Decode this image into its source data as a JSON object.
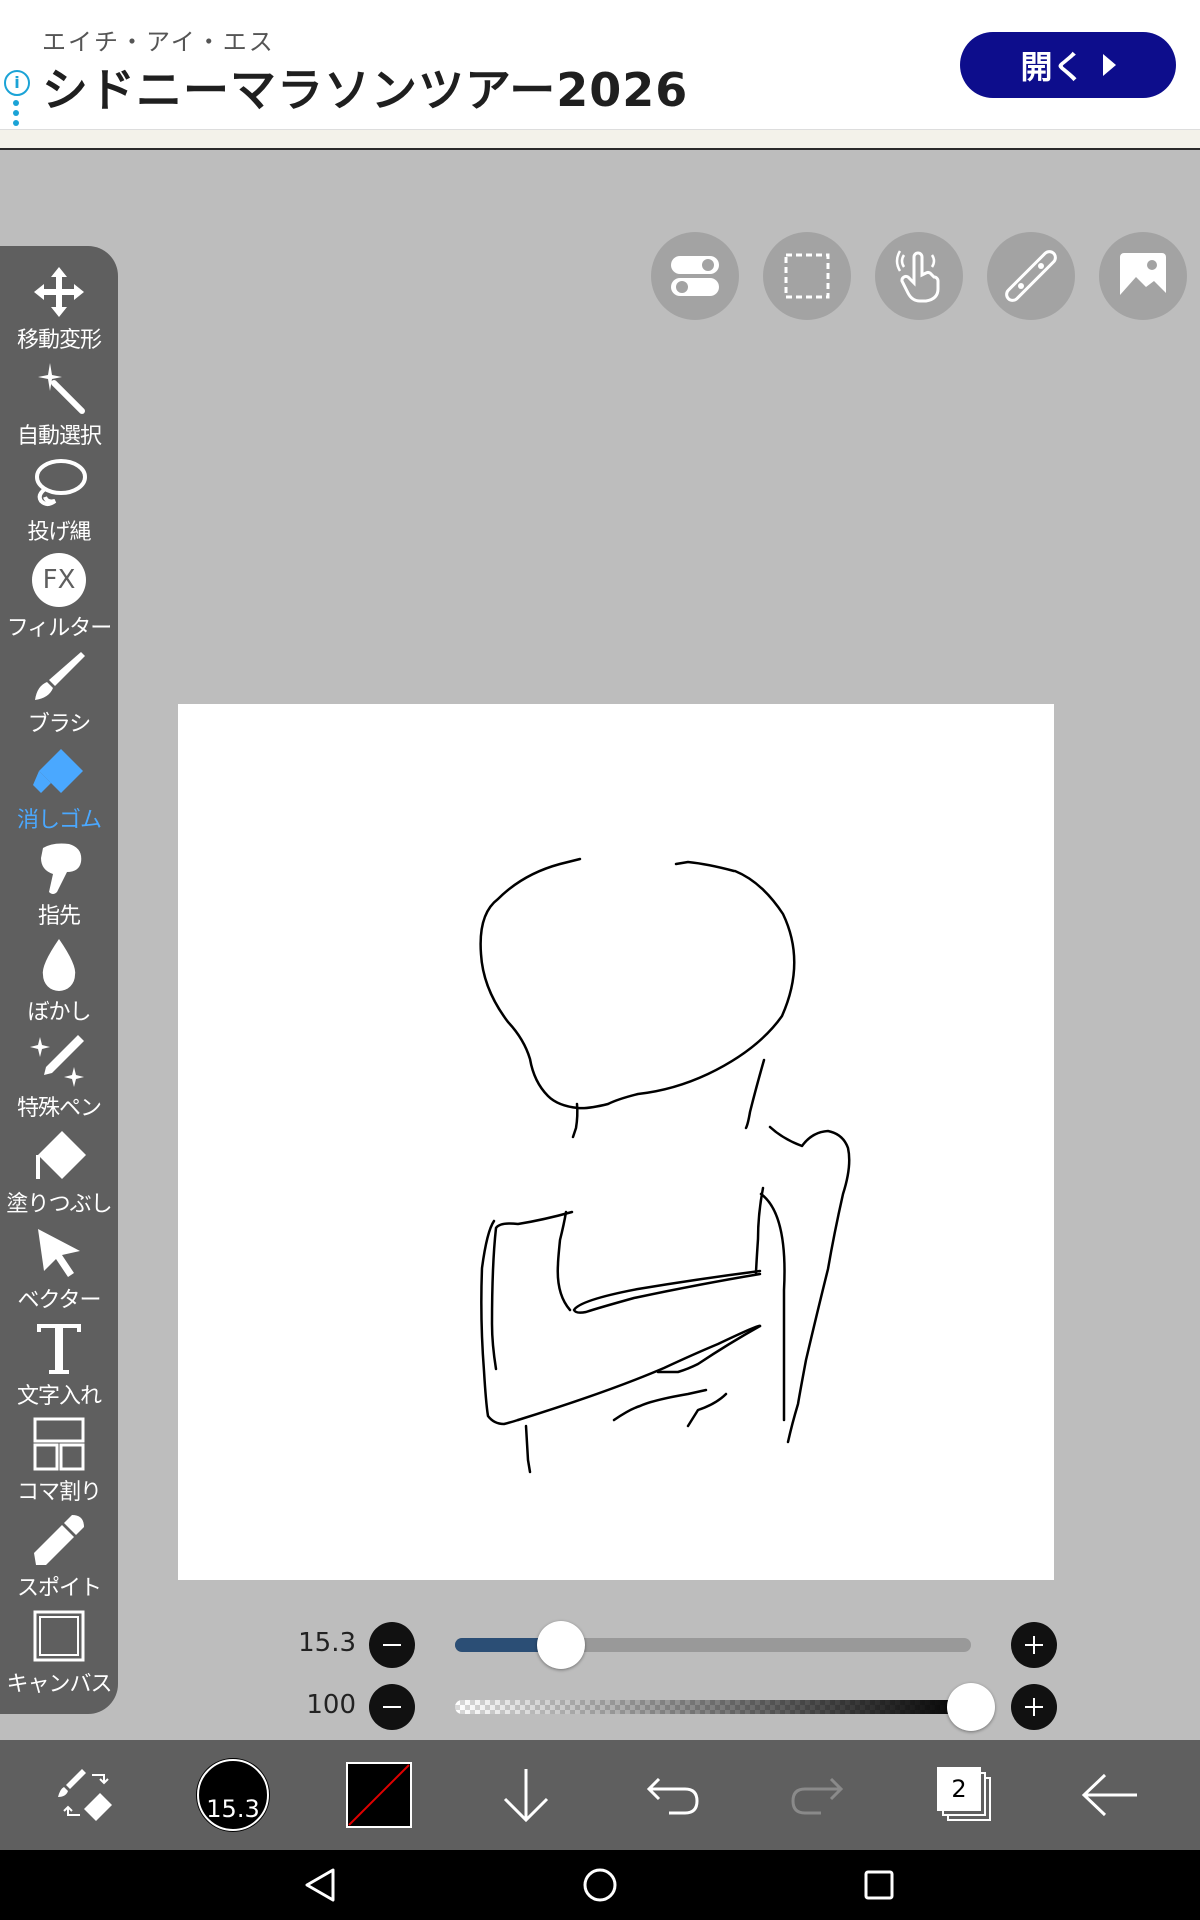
{
  "ad": {
    "subtitle": "エイチ・アイ・エス",
    "title": "シドニーマラソンツアー2026",
    "open_label": "開く",
    "info_icon": "i"
  },
  "tools": [
    {
      "label": "移動変形",
      "icon": "move-transform-icon"
    },
    {
      "label": "自動選択",
      "icon": "magic-wand-icon"
    },
    {
      "label": "投げ縄",
      "icon": "lasso-icon"
    },
    {
      "label": "フィルター",
      "icon": "fx-icon"
    },
    {
      "label": "ブラシ",
      "icon": "brush-icon"
    },
    {
      "label": "消しゴム",
      "icon": "eraser-icon",
      "active": true
    },
    {
      "label": "指先",
      "icon": "finger-icon"
    },
    {
      "label": "ぼかし",
      "icon": "blur-icon"
    },
    {
      "label": "特殊ペン",
      "icon": "special-pen-icon"
    },
    {
      "label": "塗りつぶし",
      "icon": "fill-icon"
    },
    {
      "label": "ベクター",
      "icon": "vector-icon"
    },
    {
      "label": "文字入れ",
      "icon": "text-icon"
    },
    {
      "label": "コマ割り",
      "icon": "frame-divide-icon"
    },
    {
      "label": "スポイト",
      "icon": "eyedropper-icon"
    },
    {
      "label": "キャンバス",
      "icon": "canvas-icon"
    }
  ],
  "fx_label": "FX",
  "top_buttons": [
    "toggle-icon",
    "selection-icon",
    "touch-gesture-icon",
    "ruler-icon",
    "image-material-icon"
  ],
  "size_slider": {
    "value": "15.3",
    "fraction": 0.206
  },
  "opacity_slider": {
    "value": "100",
    "fraction": 1.0
  },
  "bottom": {
    "brush_size": "15.3",
    "layer_count": "2",
    "primary_color": "#000000",
    "secondary_color": "#ffffff"
  },
  "colors": {
    "accent": "#4aa8ff",
    "slider_fill": "#2b4e75",
    "ad_button": "#0d0d8c"
  }
}
